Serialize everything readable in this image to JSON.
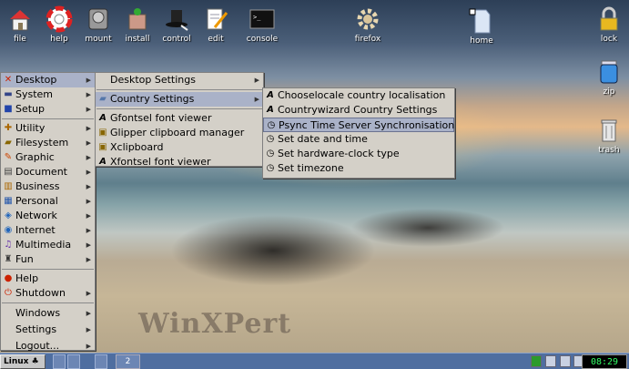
{
  "desktop": {
    "icons": [
      {
        "label": "file",
        "icon": "home-folder-icon"
      },
      {
        "label": "help",
        "icon": "lifebuoy-icon"
      },
      {
        "label": "mount",
        "icon": "drive-icon"
      },
      {
        "label": "install",
        "icon": "package-icon"
      },
      {
        "label": "control",
        "icon": "top-hat-icon"
      },
      {
        "label": "edit",
        "icon": "notepad-icon"
      },
      {
        "label": "console",
        "icon": "terminal-icon"
      },
      {
        "label": "firefox",
        "icon": "gear-icon"
      },
      {
        "label": "home",
        "icon": "folder-icon"
      },
      {
        "label": "lock",
        "icon": "padlock-icon"
      },
      {
        "label": "zip",
        "icon": "jar-icon"
      },
      {
        "label": "trash",
        "icon": "trash-can-icon"
      }
    ],
    "watermark": "WinXPert"
  },
  "main_menu": {
    "items": [
      {
        "label": "Desktop",
        "icon": "x-icon",
        "color": "#cc2200",
        "submenu": true
      },
      {
        "label": "System",
        "icon": "monitor-icon",
        "color": "#334488",
        "submenu": true
      },
      {
        "label": "Setup",
        "icon": "blue-square-icon",
        "color": "#2244aa",
        "submenu": true
      },
      {
        "label": "Utility",
        "icon": "tools-icon",
        "color": "#aa6600",
        "submenu": true
      },
      {
        "label": "Filesystem",
        "icon": "folder-icon",
        "color": "#886600",
        "submenu": true
      },
      {
        "label": "Graphic",
        "icon": "pencil-icon",
        "color": "#cc4400",
        "submenu": true
      },
      {
        "label": "Document",
        "icon": "document-icon",
        "color": "#444444",
        "submenu": true
      },
      {
        "label": "Business",
        "icon": "chart-icon",
        "color": "#aa6600",
        "submenu": true
      },
      {
        "label": "Personal",
        "icon": "calendar-icon",
        "color": "#2255aa",
        "submenu": true
      },
      {
        "label": "Network",
        "icon": "network-icon",
        "color": "#2266bb",
        "submenu": true
      },
      {
        "label": "Internet",
        "icon": "globe-icon",
        "color": "#2266bb",
        "submenu": true
      },
      {
        "label": "Multimedia",
        "icon": "media-icon",
        "color": "#6633aa",
        "submenu": true
      },
      {
        "label": "Fun",
        "icon": "joystick-icon",
        "color": "#333333",
        "submenu": true
      },
      {
        "label": "Help",
        "icon": "help-icon",
        "color": "#cc2200",
        "submenu": false
      },
      {
        "label": "Shutdown",
        "icon": "power-icon",
        "color": "#cc2200",
        "submenu": true
      },
      {
        "label": "Windows",
        "submenu": true
      },
      {
        "label": "Settings",
        "submenu": true
      },
      {
        "label": "Logout...",
        "submenu": true
      }
    ]
  },
  "desktop_submenu": {
    "items": [
      {
        "label": "Desktop Settings",
        "icon": "none",
        "submenu": true
      },
      {
        "label": "Country Settings",
        "icon": "folder-icon",
        "submenu": true
      },
      {
        "label": "Gfontsel font viewer",
        "icon": "font-icon",
        "submenu": false
      },
      {
        "label": "Glipper clipboard manager",
        "icon": "clipboard-icon",
        "submenu": false
      },
      {
        "label": "Xclipboard",
        "icon": "clipboard-icon",
        "submenu": false
      },
      {
        "label": "Xfontsel font viewer",
        "icon": "font-icon",
        "submenu": false
      }
    ]
  },
  "country_submenu": {
    "items": [
      {
        "label": "Chooselocale country localisation",
        "icon": "font-icon"
      },
      {
        "label": "Countrywizard Country Settings",
        "icon": "font-icon"
      },
      {
        "label": "Psync Time Server Synchronisation",
        "icon": "clock-icon"
      },
      {
        "label": "Set date and time",
        "icon": "clock-icon"
      },
      {
        "label": "Set hardware-clock type",
        "icon": "clock-icon"
      },
      {
        "label": "Set timezone",
        "icon": "clock-icon"
      }
    ]
  },
  "taskbar": {
    "start_label": "Linux",
    "pager": "2",
    "clock": "08:29 AM"
  }
}
